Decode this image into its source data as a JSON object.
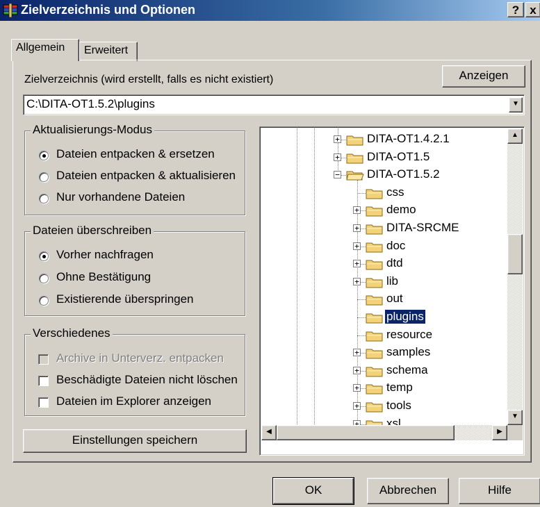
{
  "window": {
    "title": "Zielverzeichnis und Optionen",
    "help_glyph": "?",
    "close_glyph": "x",
    "icon": "winrar-books-icon"
  },
  "tabs": [
    {
      "label": "Allgemein",
      "active": true
    },
    {
      "label": "Erweitert",
      "active": false
    }
  ],
  "destination": {
    "label": "Zielverzeichnis (wird erstellt, falls es nicht existiert)",
    "show_button": "Anzeigen",
    "value": "C:\\DITA-OT1.5.2\\plugins"
  },
  "update_mode": {
    "title": "Aktualisierungs-Modus",
    "options": [
      {
        "label": "Dateien entpacken & ersetzen",
        "selected": true
      },
      {
        "label": "Dateien entpacken & aktualisieren",
        "selected": false
      },
      {
        "label": "Nur vorhandene Dateien",
        "selected": false
      }
    ]
  },
  "overwrite": {
    "title": "Dateien überschreiben",
    "options": [
      {
        "label": "Vorher nachfragen",
        "selected": true
      },
      {
        "label": "Ohne Bestätigung",
        "selected": false
      },
      {
        "label": "Existierende überspringen",
        "selected": false
      }
    ]
  },
  "misc": {
    "title": "Verschiedenes",
    "options": [
      {
        "label": "Archive in Unterverz. entpacken",
        "checked": false,
        "disabled": true
      },
      {
        "label": "Beschädigte Dateien nicht löschen",
        "checked": false,
        "disabled": false
      },
      {
        "label": "Dateien im Explorer anzeigen",
        "checked": false,
        "disabled": false
      }
    ]
  },
  "save_settings_button": "Einstellungen speichern",
  "tree": {
    "nodes": [
      {
        "label": "DITA-OT1.4.2.1",
        "level": 0,
        "expander": "+"
      },
      {
        "label": "DITA-OT1.5",
        "level": 0,
        "expander": "+"
      },
      {
        "label": "DITA-OT1.5.2",
        "level": 0,
        "expander": "-",
        "open": true
      },
      {
        "label": "css",
        "level": 1,
        "expander": ""
      },
      {
        "label": "demo",
        "level": 1,
        "expander": "+"
      },
      {
        "label": "DITA-SRCME",
        "level": 1,
        "expander": "+"
      },
      {
        "label": "doc",
        "level": 1,
        "expander": "+"
      },
      {
        "label": "dtd",
        "level": 1,
        "expander": "+"
      },
      {
        "label": "lib",
        "level": 1,
        "expander": "+"
      },
      {
        "label": "out",
        "level": 1,
        "expander": ""
      },
      {
        "label": "plugins",
        "level": 1,
        "expander": "",
        "selected": true
      },
      {
        "label": "resource",
        "level": 1,
        "expander": ""
      },
      {
        "label": "samples",
        "level": 1,
        "expander": "+"
      },
      {
        "label": "schema",
        "level": 1,
        "expander": "+"
      },
      {
        "label": "temp",
        "level": 1,
        "expander": "+"
      },
      {
        "label": "tools",
        "level": 1,
        "expander": "+"
      },
      {
        "label": "xsl",
        "level": 1,
        "expander": "+"
      }
    ]
  },
  "footer": {
    "ok": "OK",
    "cancel": "Abbrechen",
    "help": "Hilfe"
  }
}
